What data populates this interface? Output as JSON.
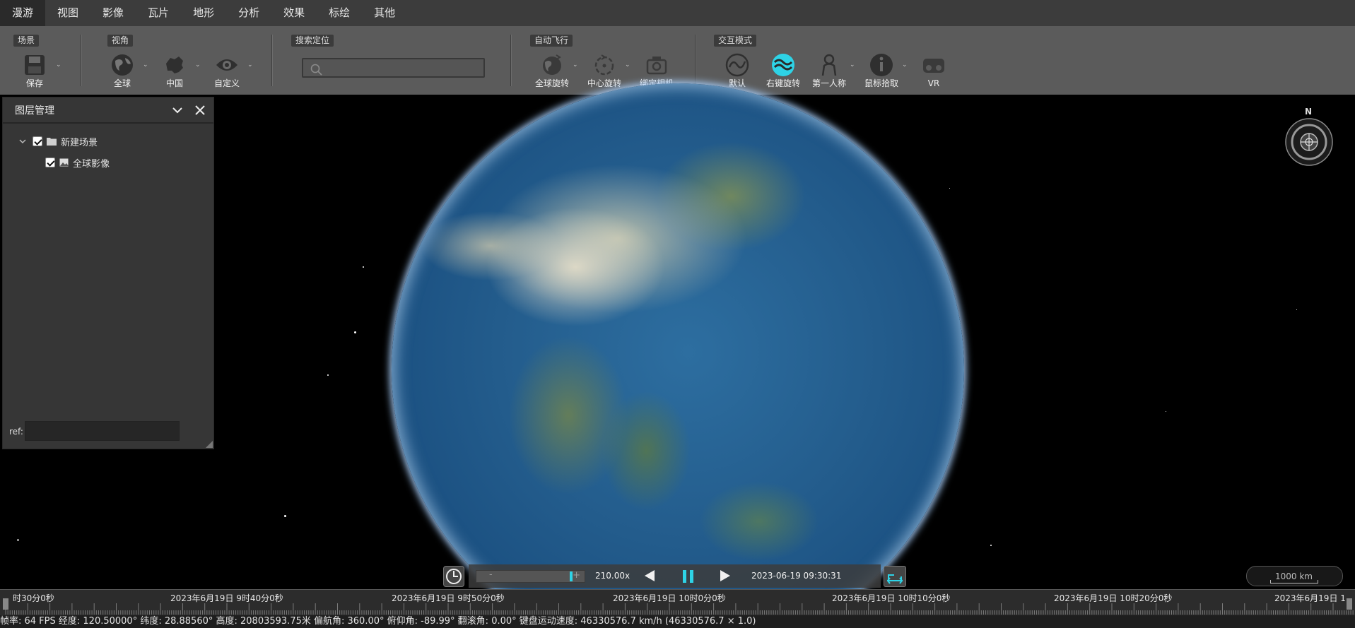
{
  "menu": {
    "items": [
      "漫游",
      "视图",
      "影像",
      "瓦片",
      "地形",
      "分析",
      "效果",
      "标绘",
      "其他"
    ],
    "active_index": 0
  },
  "toolbar": {
    "groups": {
      "scene": "场景",
      "view": "视角",
      "search": "搜索定位",
      "autofly": "自动飞行",
      "interact": "交互模式"
    },
    "tools": {
      "save": "保存",
      "globe": "全球",
      "china": "中国",
      "custom": "自定义",
      "global_rotate": "全球旋转",
      "center_rotate": "中心旋转",
      "bind_camera": "绑定相机",
      "default": "默认",
      "right_rotate": "右键旋转",
      "first_person": "第一人称",
      "mouse_pick": "鼠标拾取",
      "vr": "VR"
    },
    "search_value": "",
    "search_placeholder": ""
  },
  "layer_panel": {
    "title": "图层管理",
    "tree": {
      "scene": {
        "label": "新建场景",
        "checked": true,
        "icon": "folder-icon"
      },
      "imagery": {
        "label": "全球影像",
        "checked": true,
        "icon": "image-icon"
      }
    },
    "ref_label": "ref:",
    "ref_value": ""
  },
  "compass": {
    "north_label": "N"
  },
  "animation": {
    "multiplier": "210.00x",
    "current_time": "2023-06-19 09:30:31",
    "speed_minus": "-",
    "speed_plus": "+"
  },
  "scale": {
    "label": "1000 km"
  },
  "timeline": {
    "labels": [
      "时30分0秒",
      "2023年6月19日 9时40分0秒",
      "2023年6月19日 9时50分0秒",
      "2023年6月19日 10时0分0秒",
      "2023年6月19日 10时10分0秒",
      "2023年6月19日 10时20分0秒",
      "2023年6月19日 1"
    ]
  },
  "status": {
    "text": "帧率: 64 FPS 经度: 120.50000° 纬度: 28.88560° 高度: 20803593.75米 偏航角: 360.00° 俯仰角: -89.99° 翻滚角: 0.00° 键盘运动速度: 46330576.7 km/h (46330576.7 × 1.0)"
  },
  "colors": {
    "accent": "#2ed3e6",
    "menubar": "#3c3c3c",
    "toolbar": "#5b5b5b",
    "panel": "#363636"
  }
}
